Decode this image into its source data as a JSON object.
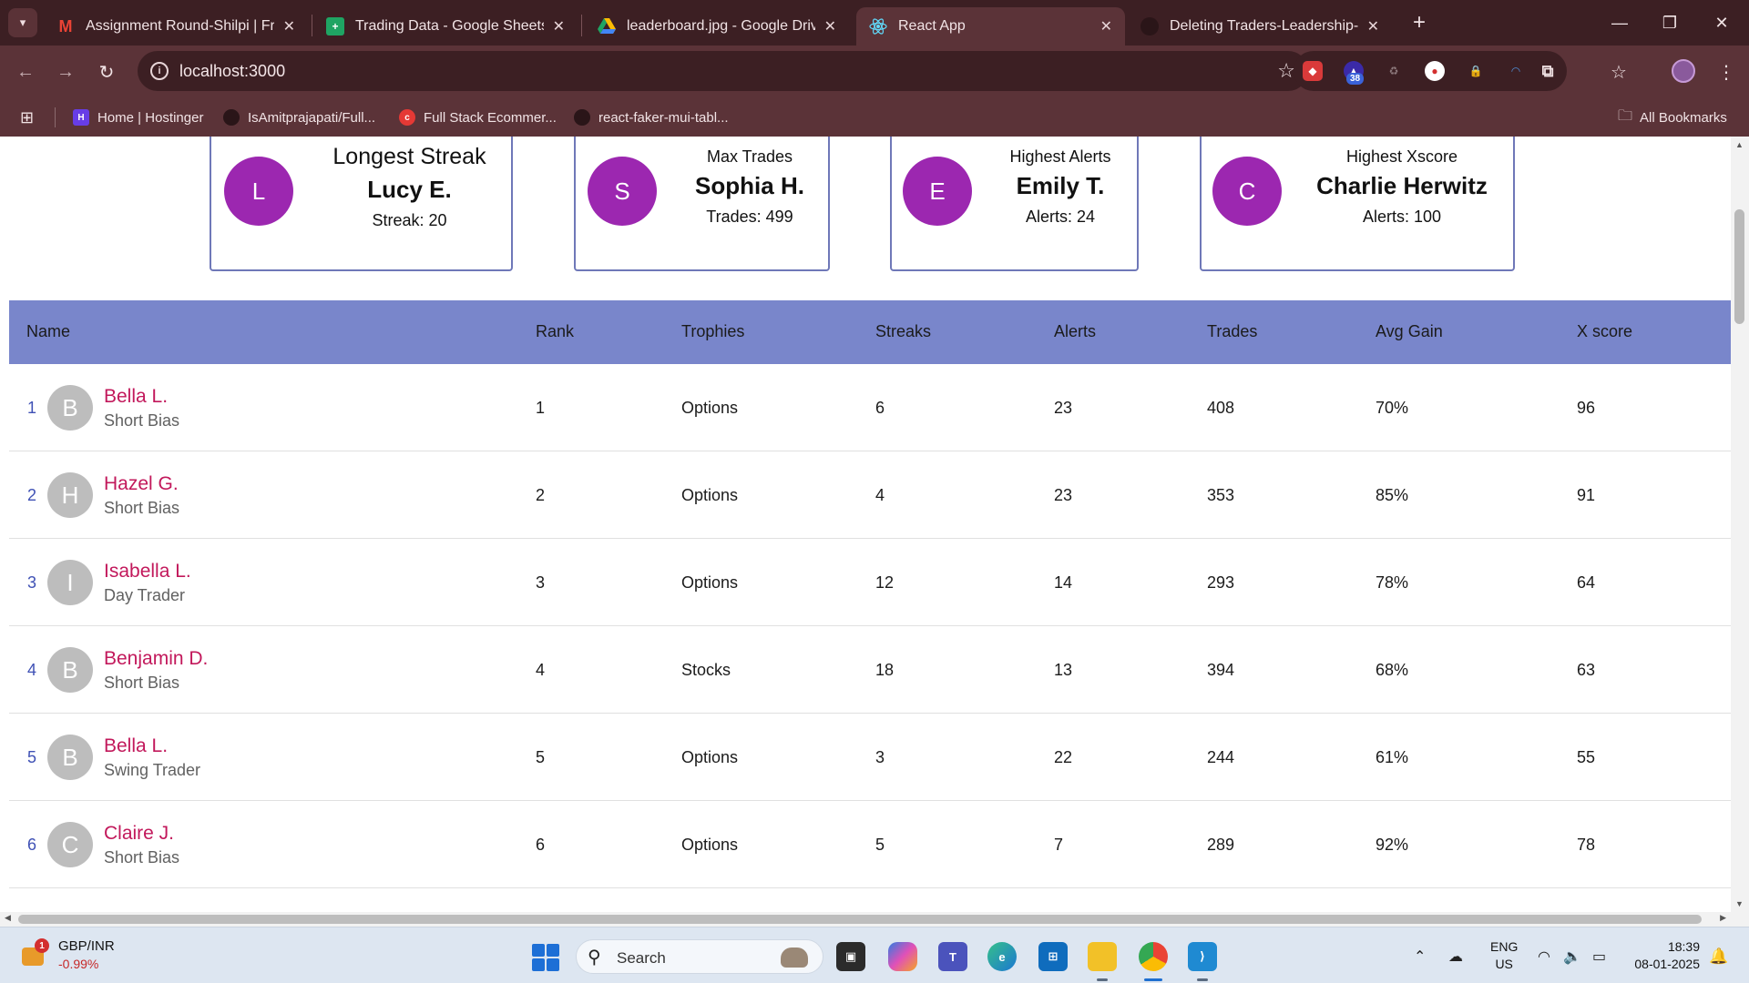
{
  "browser": {
    "tabs": [
      {
        "title": "Assignment Round-Shilpi | Fron",
        "icon": "gmail-icon",
        "active": false
      },
      {
        "title": "Trading Data - Google Sheets",
        "icon": "sheets-icon",
        "active": false
      },
      {
        "title": "leaderboard.jpg - Google Drive",
        "icon": "drive-icon",
        "active": false
      },
      {
        "title": "React App",
        "icon": "react-icon",
        "active": true
      },
      {
        "title": "Deleting Traders-Leadership-Da",
        "icon": "github-icon",
        "active": false
      }
    ],
    "url": "localhost:3000",
    "extension_badge": "38",
    "bookmarks": [
      {
        "label": "Home | Hostinger"
      },
      {
        "label": "IsAmitprajapati/Full..."
      },
      {
        "label": "Full Stack Ecommer..."
      },
      {
        "label": "react-faker-mui-tabl..."
      }
    ],
    "all_bookmarks": "All Bookmarks"
  },
  "cards": [
    {
      "title": "Longest Streak",
      "name": "Lucy E.",
      "value": "Streak: 20",
      "initial": "L"
    },
    {
      "title": "Max Trades",
      "name": "Sophia H.",
      "value": "Trades: 499",
      "initial": "S"
    },
    {
      "title": "Highest Alerts",
      "name": "Emily T.",
      "value": "Alerts: 24",
      "initial": "E"
    },
    {
      "title": "Highest Xscore",
      "name": "Charlie Herwitz",
      "value": "Alerts: 100",
      "initial": "C"
    }
  ],
  "table": {
    "headers": [
      "Name",
      "Rank",
      "Trophies",
      "Streaks",
      "Alerts",
      "Trades",
      "Avg Gain",
      "X score"
    ],
    "rows": [
      {
        "index": "1",
        "initial": "B",
        "name": "Bella L.",
        "type": "Short Bias",
        "rank": "1",
        "trophies": "Options",
        "streaks": "6",
        "alerts": "23",
        "trades": "408",
        "avg_gain": "70%",
        "xscore": "96"
      },
      {
        "index": "2",
        "initial": "H",
        "name": "Hazel G.",
        "type": "Short Bias",
        "rank": "2",
        "trophies": "Options",
        "streaks": "4",
        "alerts": "23",
        "trades": "353",
        "avg_gain": "85%",
        "xscore": "91"
      },
      {
        "index": "3",
        "initial": "I",
        "name": "Isabella L.",
        "type": "Day Trader",
        "rank": "3",
        "trophies": "Options",
        "streaks": "12",
        "alerts": "14",
        "trades": "293",
        "avg_gain": "78%",
        "xscore": "64"
      },
      {
        "index": "4",
        "initial": "B",
        "name": "Benjamin D.",
        "type": "Short Bias",
        "rank": "4",
        "trophies": "Stocks",
        "streaks": "18",
        "alerts": "13",
        "trades": "394",
        "avg_gain": "68%",
        "xscore": "63"
      },
      {
        "index": "5",
        "initial": "B",
        "name": "Bella L.",
        "type": "Swing Trader",
        "rank": "5",
        "trophies": "Options",
        "streaks": "3",
        "alerts": "22",
        "trades": "244",
        "avg_gain": "61%",
        "xscore": "55"
      },
      {
        "index": "6",
        "initial": "C",
        "name": "Claire J.",
        "type": "Short Bias",
        "rank": "6",
        "trophies": "Options",
        "streaks": "5",
        "alerts": "7",
        "trades": "289",
        "avg_gain": "92%",
        "xscore": "78"
      }
    ]
  },
  "taskbar": {
    "notification_count": "1",
    "stock_pair": "GBP/INR",
    "stock_change": "-0.99%",
    "search_placeholder": "Search",
    "lang": "ENG",
    "region": "US",
    "time": "18:39",
    "date": "08-01-2025"
  },
  "colors": {
    "table_header": "#7986cb",
    "card_avatar": "#9c27b0",
    "name_link": "#c2185b",
    "browser_frame": "#5b3338"
  }
}
